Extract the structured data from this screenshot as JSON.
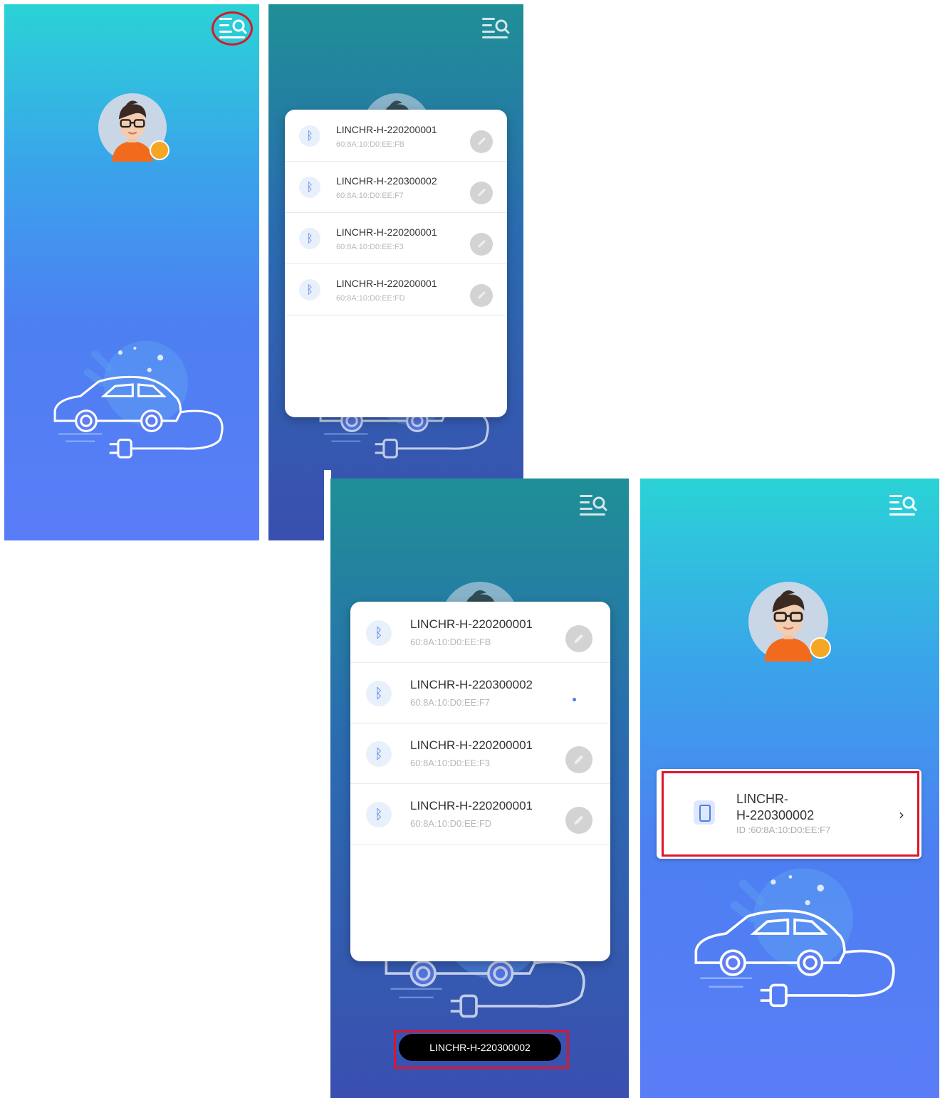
{
  "screens": {
    "s2_devices": [
      {
        "name": "LINCHR-H-220200001",
        "mac": "60:8A:10:D0:EE:FB"
      },
      {
        "name": "LINCHR-H-220300002",
        "mac": "60:8A:10:D0:EE:F7"
      },
      {
        "name": "LINCHR-H-220200001",
        "mac": "60:8A:10:D0:EE:F3"
      },
      {
        "name": "LINCHR-H-220200001",
        "mac": "60:8A:10:D0:EE:FD"
      }
    ],
    "s3_devices": [
      {
        "name": "LINCHR-H-220200001",
        "mac": "60:8A:10:D0:EE:FB"
      },
      {
        "name": "LINCHR-H-220300002",
        "mac": "60:8A:10:D0:EE:F7"
      },
      {
        "name": "LINCHR-H-220200001",
        "mac": "60:8A:10:D0:EE:F3"
      },
      {
        "name": "LINCHR-H-220200001",
        "mac": "60:8A:10:D0:EE:FD"
      }
    ],
    "toast_text": "LINCHR-H-220300002",
    "connected_card": {
      "name_line1": "LINCHR-",
      "name_line2": "H-220300002",
      "id_text": "ID :60:8A:10:D0:EE:F7"
    }
  },
  "icons": {
    "menu": "menu-search-icon",
    "bluetooth": "bluetooth-icon",
    "link": "link-icon",
    "charger": "charger-icon",
    "chevron": "chevron-right-icon",
    "edit": "edit-badge-icon"
  },
  "colors": {
    "highlight": "#e0142a",
    "accent": "#4a7fe8",
    "badge": "#f5a623"
  }
}
